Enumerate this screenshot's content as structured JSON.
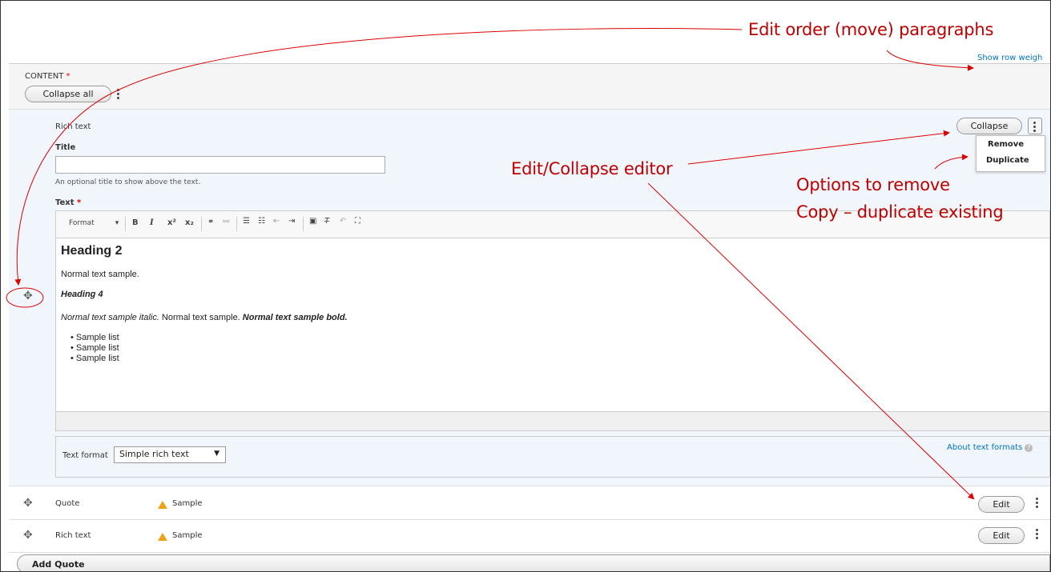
{
  "annotations": {
    "edit_order": "Edit order (move) paragraphs",
    "edit_collapse": "Edit/Collapse editor",
    "options_line1": "Options to remove",
    "options_line2": "Copy – duplicate existing"
  },
  "header": {
    "show_row_weights": "Show row weigh",
    "content_label": "CONTENT",
    "required_mark": "*",
    "collapse_all": "Collapse all"
  },
  "paragraph": {
    "type_label": "Rich text",
    "collapse_button": "Collapse",
    "menu": [
      "Remove",
      "Duplicate"
    ],
    "title_label": "Title",
    "title_value": "",
    "title_help": "An optional title to show above the text.",
    "text_label": "Text",
    "toolbar": {
      "format": "Format",
      "bold": "B",
      "italic": "I",
      "superscript": "x²",
      "subscript": "x₂"
    },
    "editor": {
      "heading2": "Heading 2",
      "normal": "Normal text sample.",
      "heading4": "Heading 4",
      "mixed_italic": "Normal text sample italic.",
      "mixed_normal": " Normal text sample. ",
      "mixed_bold": "Normal text sample bold.",
      "list": [
        "Sample list",
        "Sample list",
        "Sample list"
      ]
    },
    "text_format_label": "Text format",
    "text_format_value": "Simple rich text",
    "about_formats": "About text formats"
  },
  "rows": [
    {
      "type": "Quote",
      "summary": "Sample",
      "edit": "Edit"
    },
    {
      "type": "Rich text",
      "summary": "Sample",
      "edit": "Edit"
    }
  ],
  "footer": {
    "add_button": "Add Quote"
  },
  "colors": {
    "annotation": "#c00000",
    "link": "#0074bd",
    "warning": "#e8a317",
    "panel": "#f0f6fb"
  }
}
